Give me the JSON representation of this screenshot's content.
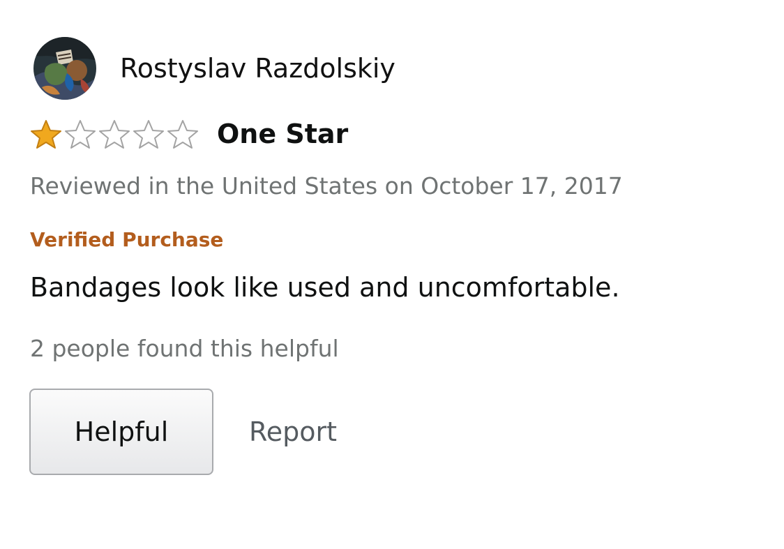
{
  "review": {
    "profile": {
      "name": "Rostyslav Razdolskiy",
      "avatar_icon": "profile-avatar-image"
    },
    "rating": {
      "value": 1,
      "max": 5,
      "filled_color": "#f0a81e",
      "empty_color": "#a3a3a3",
      "title": "One Star"
    },
    "date_text": "Reviewed in the United States on October 17, 2017",
    "verified_text": "Verified Purchase",
    "verified_color": "#b35d1d",
    "body": "Bandages look like used and uncomfortable.",
    "helpful_count_text": "2 people found this helpful",
    "actions": {
      "helpful_label": "Helpful",
      "report_label": "Report"
    }
  }
}
